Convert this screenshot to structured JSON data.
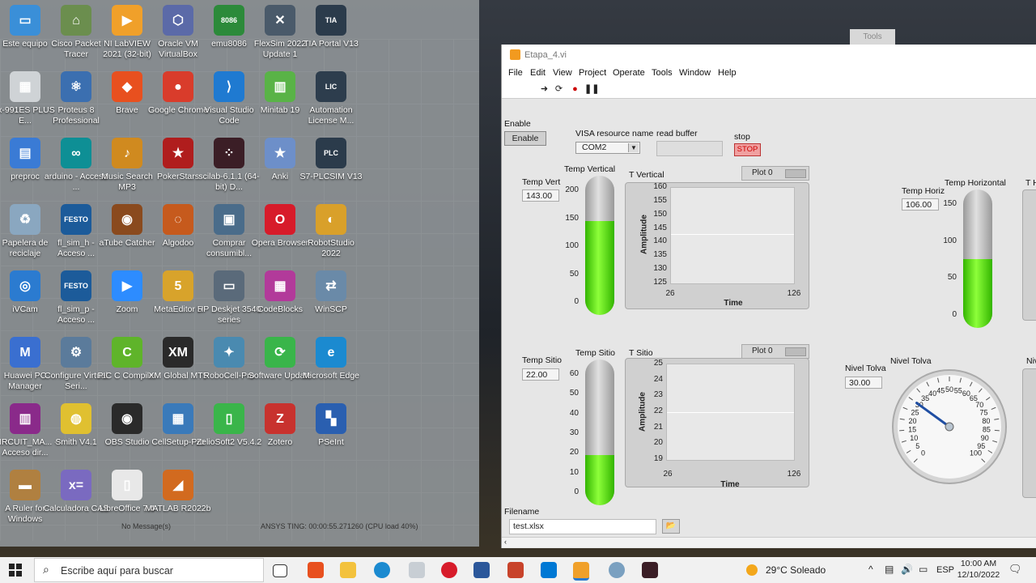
{
  "desktop": {
    "icons": [
      {
        "label": "Este equipo",
        "color": "#3a8fd8",
        "glyph": "▭"
      },
      {
        "label": "Cisco Packet Tracer",
        "color": "#6b8e4e",
        "glyph": "⌂"
      },
      {
        "label": "NI LabVIEW 2021 (32-bit)",
        "color": "#f0a02a",
        "glyph": "▶"
      },
      {
        "label": "Oracle VM VirtualBox",
        "color": "#5b6aa8",
        "glyph": "⬡"
      },
      {
        "label": "emu8086",
        "color": "#2c8a3a",
        "glyph": "8086"
      },
      {
        "label": "FlexSim 2022 Update 1",
        "color": "#4a5a6a",
        "glyph": "✕"
      },
      {
        "label": "TIA Portal V13",
        "color": "#2b3b4b",
        "glyph": "TIA"
      },
      {
        "label": "fx-991ES PLUS E...",
        "color": "#cfd3d6",
        "glyph": "▦"
      },
      {
        "label": "Proteus 8 Professional",
        "color": "#3b6fb0",
        "glyph": "⚛"
      },
      {
        "label": "Brave",
        "color": "#e8501f",
        "glyph": "◆"
      },
      {
        "label": "Google Chrome",
        "color": "#d93c2b",
        "glyph": "●"
      },
      {
        "label": "Visual Studio Code",
        "color": "#1f7ad1",
        "glyph": "⟩"
      },
      {
        "label": "Minitab 19",
        "color": "#59b347",
        "glyph": "▥"
      },
      {
        "label": "Automation License M...",
        "color": "#2d3d4d",
        "glyph": "LIC"
      },
      {
        "label": "preproc",
        "color": "#3a7bd5",
        "glyph": "▤"
      },
      {
        "label": "arduino - Acceso ...",
        "color": "#0e8f95",
        "glyph": "∞"
      },
      {
        "label": "Music Search MP3",
        "color": "#d08a1f",
        "glyph": "♪"
      },
      {
        "label": "PokerStars",
        "color": "#b01d1d",
        "glyph": "★"
      },
      {
        "label": "scilab-6.1.1 (64-bit) D...",
        "color": "#3b1e26",
        "glyph": "⁘"
      },
      {
        "label": "Anki",
        "color": "#6d8fc9",
        "glyph": "★"
      },
      {
        "label": "S7-PLCSIM V13",
        "color": "#2b3b4b",
        "glyph": "PLC"
      },
      {
        "label": "Papelera de reciclaje",
        "color": "#8aa7c0",
        "glyph": "♻"
      },
      {
        "label": "fl_sim_h - Acceso ...",
        "color": "#1c5b9a",
        "glyph": "FESTO"
      },
      {
        "label": "aTube Catcher",
        "color": "#8a4a1e",
        "glyph": "◉"
      },
      {
        "label": "Algodoo",
        "color": "#c65a1d",
        "glyph": "◌"
      },
      {
        "label": "Comprar consumibl...",
        "color": "#4a6c8a",
        "glyph": "▣"
      },
      {
        "label": "Opera Browser",
        "color": "#d71b2a",
        "glyph": "O"
      },
      {
        "label": "RobotStudio 2022",
        "color": "#d9a02a",
        "glyph": "◐"
      },
      {
        "label": "iVCam",
        "color": "#2b7bd0",
        "glyph": "◎"
      },
      {
        "label": "fl_sim_p - Acceso ...",
        "color": "#1c5b9a",
        "glyph": "FESTO"
      },
      {
        "label": "Zoom",
        "color": "#2d8cff",
        "glyph": "▶"
      },
      {
        "label": "MetaEditor 5",
        "color": "#d8a32b",
        "glyph": "5"
      },
      {
        "label": "HP Deskjet 3540 series",
        "color": "#5a6a7a",
        "glyph": "▭"
      },
      {
        "label": "CodeBlocks",
        "color": "#b23a9a",
        "glyph": "▦"
      },
      {
        "label": "WinSCP",
        "color": "#6a8aa8",
        "glyph": "⇄"
      },
      {
        "label": "Huawei PC Manager",
        "color": "#3a6fd0",
        "glyph": "M"
      },
      {
        "label": "Configure Virtual Seri...",
        "color": "#5b7b9b",
        "glyph": "⚙"
      },
      {
        "label": "PIC C Compiler",
        "color": "#5fb42a",
        "glyph": "C"
      },
      {
        "label": "XM Global MT5",
        "color": "#2a2a2a",
        "glyph": "XM"
      },
      {
        "label": "RoboCell-Pro",
        "color": "#4a8ab0",
        "glyph": "✦"
      },
      {
        "label": "Software Update",
        "color": "#39b54a",
        "glyph": "⟳"
      },
      {
        "label": "Microsoft Edge",
        "color": "#1b8ad0",
        "glyph": "e"
      },
      {
        "label": "CIRCUIT_MA... - Acceso dir...",
        "color": "#8a2a8a",
        "glyph": "▥"
      },
      {
        "label": "Smith V4.1",
        "color": "#e0c030",
        "glyph": "◍"
      },
      {
        "label": "OBS Studio",
        "color": "#2a2a2a",
        "glyph": "◉"
      },
      {
        "label": "CellSetup-Pro",
        "color": "#3a7aba",
        "glyph": "▦"
      },
      {
        "label": "ZelioSoft2 V5.4.2",
        "color": "#3ab54a",
        "glyph": "▯"
      },
      {
        "label": "Zotero",
        "color": "#c8322e",
        "glyph": "Z"
      },
      {
        "label": "PSeInt",
        "color": "#2a5fb0",
        "glyph": "▚"
      },
      {
        "label": "A Ruler for Windows",
        "color": "#b08040",
        "glyph": "▬"
      },
      {
        "label": "Calculadora CAS",
        "color": "#7a6ac0",
        "glyph": "x="
      },
      {
        "label": "LibreOffice 7.4",
        "color": "#e8e8e8",
        "glyph": "▯"
      },
      {
        "label": "MATLAB R2022b",
        "color": "#d26a1f",
        "glyph": "◢"
      }
    ],
    "bg_tools": "Tools",
    "bg_status_left": "No Message(s)",
    "bg_status_right": "ANSYS TING: 00:00:55.271260 (CPU load 40%)"
  },
  "labview": {
    "title": "Etapa_4.vi",
    "menu": [
      "File",
      "Edit",
      "View",
      "Project",
      "Operate",
      "Tools",
      "Window",
      "Help"
    ],
    "enable_label": "Enable",
    "enable_button": "Enable",
    "visa_label": "VISA resource name",
    "visa_value": "COM2",
    "read_buffer_label": "read buffer",
    "read_buffer_value": "",
    "stop_label": "stop",
    "stop_button": "STOP",
    "temp_vert": {
      "label": "Temp Vert",
      "value": "143.00",
      "thermo_label": "Temp Vertical",
      "ticks": [
        "200",
        "150",
        "100",
        "50",
        "0"
      ],
      "level": 0.715
    },
    "t_vertical": {
      "title": "T Vertical",
      "legend": "Plot 0",
      "ylabel": "Amplitude",
      "xlabel": "Time",
      "yticks": [
        "160",
        "155",
        "150",
        "145",
        "140",
        "135",
        "130",
        "125"
      ],
      "xticks": [
        "26",
        "126"
      ],
      "ylim": [
        125,
        160
      ],
      "value": 143
    },
    "temp_horiz": {
      "label": "Temp Horiz",
      "value": "106.00",
      "thermo_label": "Temp Horizontal",
      "ticks": [
        "150",
        "100",
        "50",
        "0"
      ],
      "level": 0.53
    },
    "temp_sitio": {
      "label": "Temp Sitio",
      "value": "22.00",
      "thermo_label": "Temp Sitio",
      "ticks": [
        "60",
        "50",
        "40",
        "30",
        "20",
        "10",
        "0"
      ],
      "level": 0.367
    },
    "t_sitio": {
      "title": "T Sitio",
      "legend": "Plot 0",
      "ylabel": "Amplitude",
      "xlabel": "Time",
      "yticks": [
        "25",
        "24",
        "23",
        "22",
        "21",
        "20",
        "19"
      ],
      "xticks": [
        "26",
        "126"
      ],
      "ylim": [
        19,
        25
      ],
      "value": 22
    },
    "nivel_tolva": {
      "label": "Nivel Tolva",
      "value": "30.00",
      "gauge_label": "Nivel Tolva",
      "ticks": [
        "0",
        "5",
        "10",
        "15",
        "20",
        "25",
        "30",
        "35",
        "40",
        "45",
        "50",
        "55",
        "60",
        "65",
        "70",
        "75",
        "80",
        "85",
        "90",
        "95",
        "100"
      ],
      "value_num": 30
    },
    "right_cut_1": "T H",
    "right_cut_2": "Niv",
    "filename_label": "Filename",
    "filename_value": "test.xlsx"
  },
  "taskbar": {
    "search_placeholder": "Escribe aquí para buscar",
    "weather": "29°C  Soleado",
    "lang": "ESP",
    "time": "10:00 AM",
    "date": "12/10/2022"
  }
}
